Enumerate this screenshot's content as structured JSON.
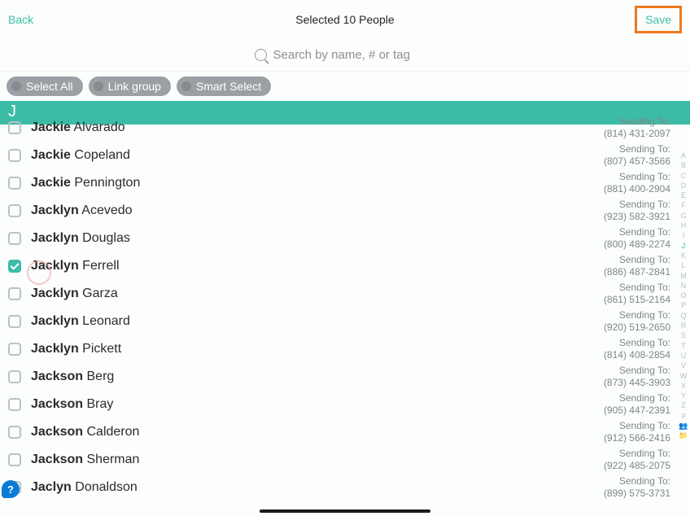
{
  "header": {
    "back_label": "Back",
    "title": "Selected 10 People",
    "save_label": "Save"
  },
  "search": {
    "placeholder": "Search by name, # or tag"
  },
  "chips": {
    "select_all": "Select All",
    "link_group": "Link group",
    "smart_select": "Smart Select"
  },
  "section_letter": "J",
  "sending_to_label": "Sending To:",
  "contacts": [
    {
      "first": "Jackie",
      "last": "Alvarado",
      "phone": "(814) 431-2097",
      "checked": false
    },
    {
      "first": "Jackie",
      "last": "Copeland",
      "phone": "(807) 457-3566",
      "checked": false
    },
    {
      "first": "Jackie",
      "last": "Pennington",
      "phone": "(881) 400-2904",
      "checked": false
    },
    {
      "first": "Jacklyn",
      "last": "Acevedo",
      "phone": "(923) 582-3921",
      "checked": false
    },
    {
      "first": "Jacklyn",
      "last": "Douglas",
      "phone": "(800) 489-2274",
      "checked": false
    },
    {
      "first": "Jacklyn",
      "last": "Ferrell",
      "phone": "(886) 487-2841",
      "checked": true
    },
    {
      "first": "Jacklyn",
      "last": "Garza",
      "phone": "(861) 515-2164",
      "checked": false
    },
    {
      "first": "Jacklyn",
      "last": "Leonard",
      "phone": "(920) 519-2650",
      "checked": false
    },
    {
      "first": "Jacklyn",
      "last": "Pickett",
      "phone": "(814) 408-2854",
      "checked": false
    },
    {
      "first": "Jackson",
      "last": "Berg",
      "phone": "(873) 445-3903",
      "checked": false
    },
    {
      "first": "Jackson",
      "last": "Bray",
      "phone": "(905) 447-2391",
      "checked": false
    },
    {
      "first": "Jackson",
      "last": "Calderon",
      "phone": "(912) 566-2416",
      "checked": false
    },
    {
      "first": "Jackson",
      "last": "Sherman",
      "phone": "(922) 485-2075",
      "checked": false
    },
    {
      "first": "Jaclyn",
      "last": "Donaldson",
      "phone": "(899) 575-3731",
      "checked": false
    }
  ],
  "index_letters": [
    "A",
    "B",
    "C",
    "D",
    "E",
    "F",
    "G",
    "H",
    "I",
    "J",
    "K",
    "L",
    "M",
    "N",
    "O",
    "P",
    "Q",
    "R",
    "S",
    "T",
    "U",
    "V",
    "W",
    "X",
    "Y",
    "Z",
    "#"
  ],
  "index_active": "J"
}
